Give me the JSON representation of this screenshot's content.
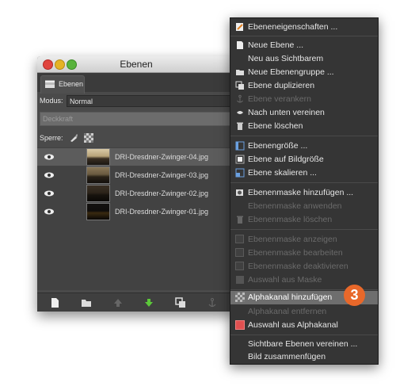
{
  "window": {
    "title": "Ebenen",
    "tab_label": "Ebenen",
    "mode_label": "Modus:",
    "mode_value": "Normal",
    "opacity_label": "Deckkraft",
    "lock_label": "Sperre:"
  },
  "layers": [
    {
      "name": "DRI-Dresdner-Zwinger-04.jpg",
      "selected": true
    },
    {
      "name": "DRI-Dresdner-Zwinger-03.jpg",
      "selected": false
    },
    {
      "name": "DRI-Dresdner-Zwinger-02.jpg",
      "selected": false
    },
    {
      "name": "DRI-Dresdner-Zwinger-01.jpg",
      "selected": false
    }
  ],
  "menu": {
    "items": [
      {
        "label": "Ebeneneigenschaften ...",
        "enabled": true,
        "icon": "layer-properties-icon"
      },
      {
        "label": "Neue Ebene ...",
        "enabled": true,
        "icon": "new-layer-icon"
      },
      {
        "label": "Neu aus Sichtbarem",
        "enabled": true,
        "icon": ""
      },
      {
        "label": "Neue Ebenengruppe ...",
        "enabled": true,
        "icon": "new-group-icon"
      },
      {
        "label": "Ebene duplizieren",
        "enabled": true,
        "icon": "duplicate-icon"
      },
      {
        "label": "Ebene verankern",
        "enabled": false,
        "icon": "anchor-icon"
      },
      {
        "label": "Nach unten vereinen",
        "enabled": true,
        "icon": "merge-down-icon"
      },
      {
        "label": "Ebene löschen",
        "enabled": true,
        "icon": "delete-icon"
      },
      {
        "label": "Ebenengröße ...",
        "enabled": true,
        "icon": "layer-size-icon"
      },
      {
        "label": "Ebene auf Bildgröße",
        "enabled": true,
        "icon": "layer-to-image-size-icon"
      },
      {
        "label": "Ebene skalieren ...",
        "enabled": true,
        "icon": "scale-layer-icon"
      },
      {
        "label": "Ebenenmaske hinzufügen ...",
        "enabled": true,
        "icon": "add-mask-icon"
      },
      {
        "label": "Ebenenmaske anwenden",
        "enabled": false,
        "icon": ""
      },
      {
        "label": "Ebenenmaske löschen",
        "enabled": false,
        "icon": "delete-mask-icon"
      },
      {
        "label": "Ebenenmaske anzeigen",
        "enabled": false,
        "icon": "checkbox"
      },
      {
        "label": "Ebenenmaske bearbeiten",
        "enabled": false,
        "icon": "checkbox"
      },
      {
        "label": "Ebenenmaske deaktivieren",
        "enabled": false,
        "icon": "checkbox"
      },
      {
        "label": "Auswahl aus Maske",
        "enabled": false,
        "icon": "mask-selection-icon"
      },
      {
        "label": "Alphakanal hinzufügen",
        "enabled": true,
        "icon": "add-alpha-icon",
        "highlighted": true
      },
      {
        "label": "Alphakanal entfernen",
        "enabled": false,
        "icon": ""
      },
      {
        "label": "Auswahl aus Alphakanal",
        "enabled": true,
        "icon": "alpha-selection-icon"
      },
      {
        "label": "Sichtbare Ebenen vereinen ...",
        "enabled": true,
        "icon": ""
      },
      {
        "label": "Bild zusammenfügen",
        "enabled": true,
        "icon": ""
      }
    ]
  },
  "badge": "3",
  "colors": {
    "badge": "#e8682a",
    "highlight": "#6e6e6e",
    "menu_bg": "#353535"
  }
}
